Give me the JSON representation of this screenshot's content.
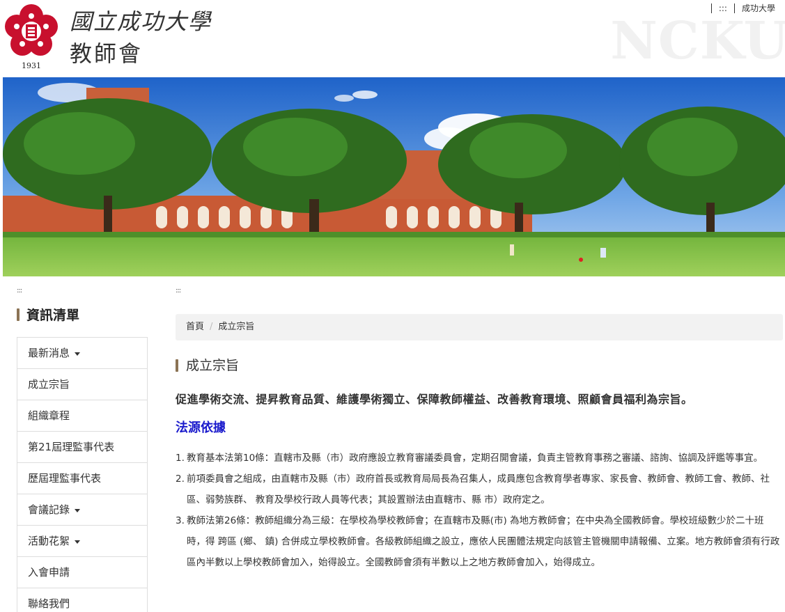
{
  "header": {
    "logo_year": "1931",
    "title_script": "國立成功大學",
    "title_main": "教師會",
    "watermark": "NCKU",
    "top_links": {
      "accesskey": ":::",
      "university": "成功大學"
    }
  },
  "banner": {
    "alt": "成功大學校園"
  },
  "accessibility_markers": {
    "left": ":::",
    "main": ":::"
  },
  "sidebar": {
    "title": "資訊清單",
    "items": [
      {
        "label": "最新消息",
        "has_dropdown": true
      },
      {
        "label": "成立宗旨",
        "has_dropdown": false
      },
      {
        "label": "組織章程",
        "has_dropdown": false
      },
      {
        "label": "第21屆理監事代表",
        "has_dropdown": false
      },
      {
        "label": "歷屆理監事代表",
        "has_dropdown": false
      },
      {
        "label": "會議記錄",
        "has_dropdown": true
      },
      {
        "label": "活動花絮",
        "has_dropdown": true
      },
      {
        "label": "入會申請",
        "has_dropdown": false
      },
      {
        "label": "聯絡我們",
        "has_dropdown": false
      }
    ]
  },
  "breadcrumb": {
    "home": "首頁",
    "divider": "/",
    "current": "成立宗旨"
  },
  "main": {
    "title": "成立宗旨",
    "purpose": "促進學術交流、提昇教育品質、維護學術獨立、保障教師權益、改善教育環境、照顧會員福利為宗旨。",
    "law_heading": "法源依據",
    "laws": [
      {
        "num": "1.",
        "text": "教育基本法第10條：直轄市及縣（市）政府應設立教育審議委員會，定期召開會議，負責主管教育事務之審議、諮詢、協調及評鑑等事宜。"
      },
      {
        "num": "2.",
        "text": "前項委員會之組成，由直轄市及縣（市）政府首長或教育局局長為召集人，成員應包含教育學者專家、家長會、教師會、教師工會、教師、社區、弱勢族群、 教育及學校行政人員等代表；其設置辦法由直轄市、縣 市）政府定之。"
      },
      {
        "num": "3.",
        "text": "教師法第26條：教師組織分為三級：在學校為學校教師會；在直轄市及縣(市) 為地方教師會；在中央為全國教師會。學校班級數少於二十班時，得 跨區 (鄉、 鎮) 合併成立學校教師會。各級教師組織之設立，應依人民團體法規定向該管主管機關申請報備、立案。地方教師會須有行政區內半數以上學校教師會加入，始得設立。全國教師會須有半數以上之地方教師會加入，始得成立。"
      }
    ]
  },
  "colors": {
    "accent_bar": "#8b7355",
    "law_heading": "#1a1acc",
    "logo_red": "#c8102e",
    "breadcrumb_bg": "#f2f2f2"
  }
}
